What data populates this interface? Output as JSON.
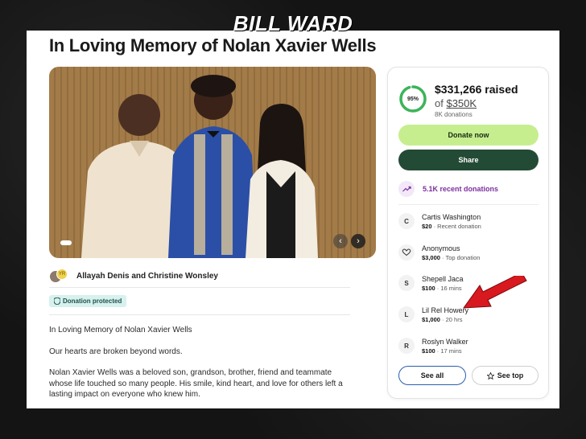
{
  "watermark": "BILL WARD",
  "title": "In Loving Memory of Nolan Xavier Wells",
  "organizer": {
    "avatar_badge": "YR",
    "name": "Allayah Denis and Christine Wonsley"
  },
  "badge": "Donation protected",
  "story": [
    "In Loving Memory of Nolan Xavier Wells",
    "Our hearts are broken beyond words.",
    "Nolan Xavier Wells was a beloved son, grandson, brother, friend and teammate whose life touched so many people. His smile, kind heart, and love for others left a lasting impact on everyone who knew him."
  ],
  "fundraiser": {
    "percent_label": "95%",
    "percent": 0.95,
    "raised": "$331,266 raised",
    "goal_prefix": "of ",
    "goal": "$350K",
    "donations": "8K donations",
    "donate_label": "Donate now",
    "share_label": "Share",
    "recent_label": "5.1K recent donations"
  },
  "donors": [
    {
      "initial": "C",
      "name": "Cartis Washington",
      "amount": "$20",
      "meta": " · Recent donation"
    },
    {
      "initial": "",
      "name": "Anonymous",
      "amount": "$3,000",
      "meta": " · Top donation"
    },
    {
      "initial": "S",
      "name": "Shepell Jaca",
      "amount": "$100",
      "meta": " · 16 mins"
    },
    {
      "initial": "L",
      "name": "Lil Rel Howery",
      "amount": "$1,000",
      "meta": " · 20 hrs"
    },
    {
      "initial": "R",
      "name": "Roslyn Walker",
      "amount": "$100",
      "meta": " · 17 mins"
    }
  ],
  "buttons": {
    "see_all": "See all",
    "see_top": "See top"
  },
  "colors": {
    "accent_green": "#c6ee8f",
    "share_dark_green": "#234a35",
    "ring_green": "#3cb45a",
    "recent_purple": "#7b2fa1",
    "arrow_red": "#d8191f"
  },
  "icons": {
    "trend": "trending-up-icon",
    "heart_hand": "heart-hand-icon",
    "star": "star-icon",
    "shield": "shield-icon",
    "prev": "chevron-left-icon",
    "next": "chevron-right-icon"
  }
}
